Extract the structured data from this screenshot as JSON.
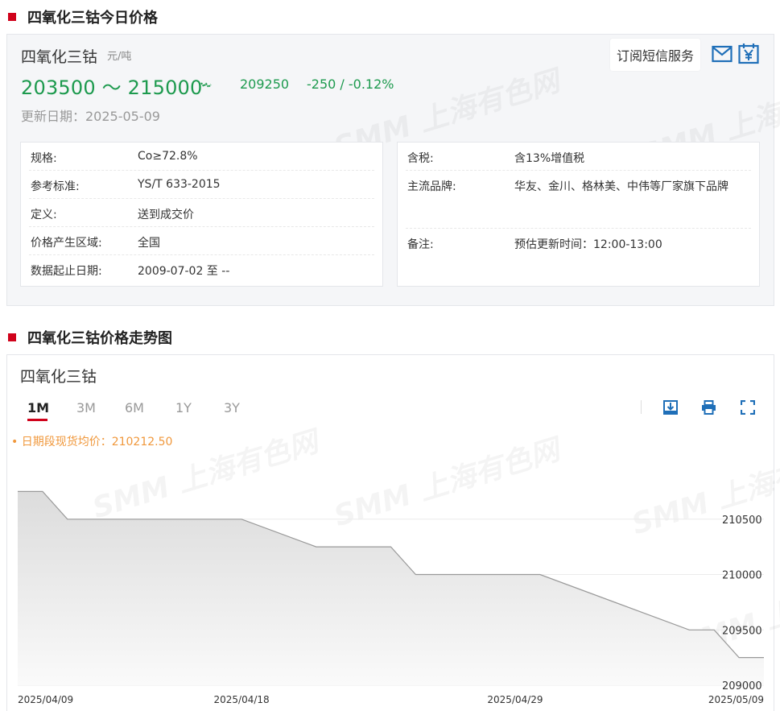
{
  "section1": {
    "title": "四氧化三钴今日价格"
  },
  "product": {
    "name": "四氧化三钴",
    "unit": "元/吨",
    "price_range": "203500 ～ 215000",
    "avg_price": "209250",
    "change": "-250  /  -0.12%",
    "update_date": "更新日期：2025-05-09",
    "sms_label": "订阅短信服务",
    "trend_color": "#1d9a4e"
  },
  "left_info": [
    {
      "key": "规格:",
      "value": "Co≥72.8%"
    },
    {
      "key": "参考标准:",
      "value": "YS/T 633-2015"
    },
    {
      "key": "定义:",
      "value": "送到成交价"
    },
    {
      "key": "价格产生区域:",
      "value": "全国"
    },
    {
      "key": "数据起止日期:",
      "value": "2009-07-02 至 --"
    }
  ],
  "right_info": [
    {
      "key": "含税:",
      "value": "含13%增值税"
    },
    {
      "key": "主流品牌:",
      "value": "华友、金川、格林美、中伟等厂家旗下品牌"
    },
    {
      "key": "备注:",
      "value": "预估更新时间：12:00-13:00"
    }
  ],
  "section2": {
    "title": "四氧化三钴价格走势图"
  },
  "chart_panel": {
    "title": "四氧化三钴",
    "tabs": [
      "1M",
      "3M",
      "6M",
      "1Y",
      "3Y"
    ],
    "active_tab": "1M",
    "avg_label": "• 日期段现货均价：210212.50",
    "watermark": "SMM 上海有色网"
  },
  "chart_data": {
    "type": "area",
    "x": [
      "2025/04/09",
      "2025/04/10",
      "2025/04/11",
      "2025/04/14",
      "2025/04/15",
      "2025/04/16",
      "2025/04/17",
      "2025/04/18",
      "2025/04/21",
      "2025/04/22",
      "2025/04/23",
      "2025/04/24",
      "2025/04/25",
      "2025/04/28",
      "2025/04/29",
      "2025/04/30",
      "2025/05/06",
      "2025/05/07",
      "2025/05/08",
      "2025/05/09"
    ],
    "values": [
      210750,
      210750,
      210500,
      210500,
      210500,
      210500,
      210500,
      210500,
      210250,
      210250,
      210250,
      210250,
      210000,
      210000,
      210000,
      210000,
      209500,
      209500,
      209250,
      209250
    ],
    "series_points": [
      {
        "date": "2025/04/09",
        "value": 210750
      },
      {
        "date": "2025/04/10",
        "value": 210750
      },
      {
        "date": "2025/04/11",
        "value": 210500
      },
      {
        "date": "2025/04/14",
        "value": 210500
      },
      {
        "date": "2025/04/15",
        "value": 210500
      },
      {
        "date": "2025/04/16",
        "value": 210500
      },
      {
        "date": "2025/04/17",
        "value": 210500
      },
      {
        "date": "2025/04/18",
        "value": 210500
      },
      {
        "date": "2025/04/21",
        "value": 210250
      },
      {
        "date": "2025/04/22",
        "value": 210250
      },
      {
        "date": "2025/04/23",
        "value": 210250
      },
      {
        "date": "2025/04/24",
        "value": 210250
      },
      {
        "date": "2025/04/25",
        "value": 210000
      },
      {
        "date": "2025/04/28",
        "value": 210000
      },
      {
        "date": "2025/04/29",
        "value": 210000
      },
      {
        "date": "2025/04/30",
        "value": 210000
      },
      {
        "date": "2025/05/06",
        "value": 209500
      },
      {
        "date": "2025/05/07",
        "value": 209500
      },
      {
        "date": "2025/05/08",
        "value": 209250
      },
      {
        "date": "2025/05/09",
        "value": 209250
      }
    ],
    "x_tick_labels": [
      "2025/04/09",
      "2025/04/18",
      "2025/04/29",
      "2025/05/09"
    ],
    "y_tick_labels": [
      "210500",
      "210000",
      "209500",
      "209000"
    ],
    "ylim": [
      209000,
      211000
    ],
    "grid": true,
    "line_color": "#999999"
  }
}
